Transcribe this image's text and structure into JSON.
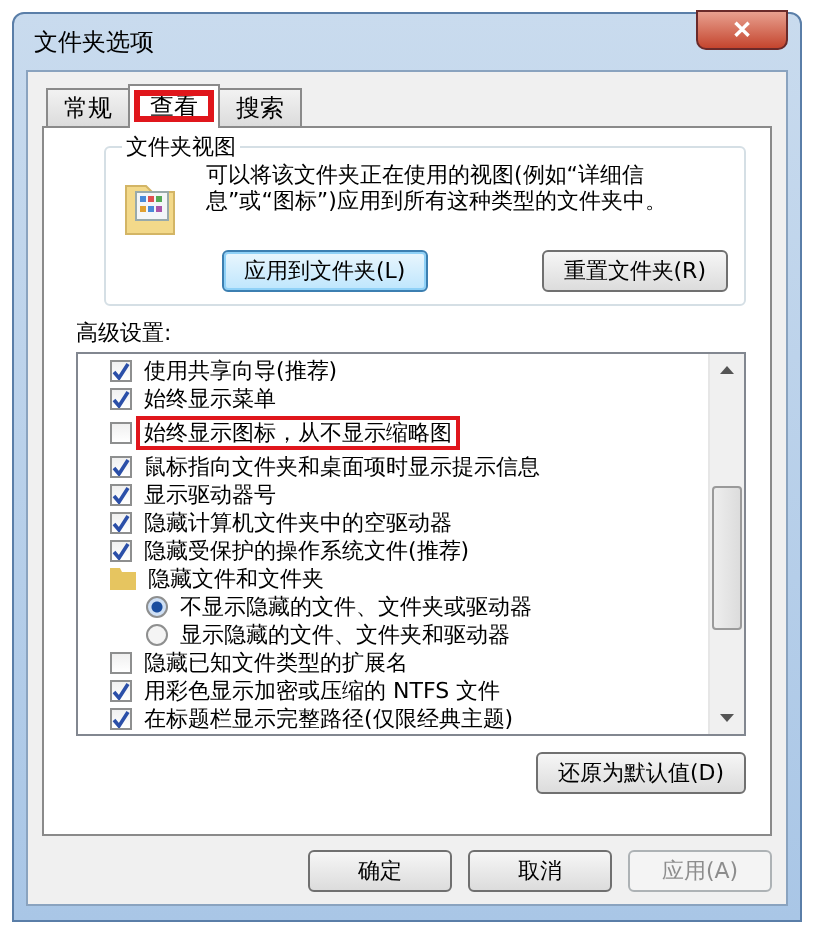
{
  "window": {
    "title": "文件夹选项",
    "close": "✕"
  },
  "tabs": [
    {
      "label": "常规",
      "selected": false,
      "highlighted": false
    },
    {
      "label": "查看",
      "selected": true,
      "highlighted": true
    },
    {
      "label": "搜索",
      "selected": false,
      "highlighted": false
    }
  ],
  "folder_views": {
    "title": "文件夹视图",
    "description": "可以将该文件夹正在使用的视图(例如“详细信息”或“图标”)应用到所有这种类型的文件夹中。",
    "buttons": [
      {
        "label": "应用到文件夹(L)",
        "default": true
      },
      {
        "label": "重置文件夹(R)",
        "default": false
      }
    ]
  },
  "advanced": {
    "label": "高级设置:",
    "items": [
      {
        "kind": "checkbox",
        "label": "使用共享向导(推荐)",
        "checked": true,
        "highlighted": false
      },
      {
        "kind": "checkbox",
        "label": "始终显示菜单",
        "checked": true,
        "highlighted": false
      },
      {
        "kind": "checkbox",
        "label": "始终显示图标，从不显示缩略图",
        "checked": false,
        "highlighted": true
      },
      {
        "kind": "checkbox",
        "label": "鼠标指向文件夹和桌面项时显示提示信息",
        "checked": true,
        "highlighted": false
      },
      {
        "kind": "checkbox",
        "label": "显示驱动器号",
        "checked": true,
        "highlighted": false
      },
      {
        "kind": "checkbox",
        "label": "隐藏计算机文件夹中的空驱动器",
        "checked": true,
        "highlighted": false
      },
      {
        "kind": "checkbox",
        "label": "隐藏受保护的操作系统文件(推荐)",
        "checked": true,
        "highlighted": false
      },
      {
        "kind": "folder",
        "label": "隐藏文件和文件夹",
        "highlighted": false,
        "children": [
          {
            "kind": "radio",
            "label": "不显示隐藏的文件、文件夹或驱动器",
            "selected": true,
            "highlighted": false
          },
          {
            "kind": "radio",
            "label": "显示隐藏的文件、文件夹和驱动器",
            "selected": false,
            "highlighted": false
          }
        ]
      },
      {
        "kind": "checkbox",
        "label": "隐藏已知文件类型的扩展名",
        "checked": false,
        "highlighted": false
      },
      {
        "kind": "checkbox",
        "label": "用彩色显示加密或压缩的 NTFS 文件",
        "checked": true,
        "highlighted": false
      },
      {
        "kind": "checkbox",
        "label": "在标题栏显示完整路径(仅限经典主题)",
        "checked": true,
        "highlighted": false
      }
    ],
    "restore_button": "还原为默认值(D)"
  },
  "buttons": [
    {
      "label": "确定",
      "disabled": false
    },
    {
      "label": "取消",
      "disabled": false
    },
    {
      "label": "应用(A)",
      "disabled": true
    }
  ]
}
